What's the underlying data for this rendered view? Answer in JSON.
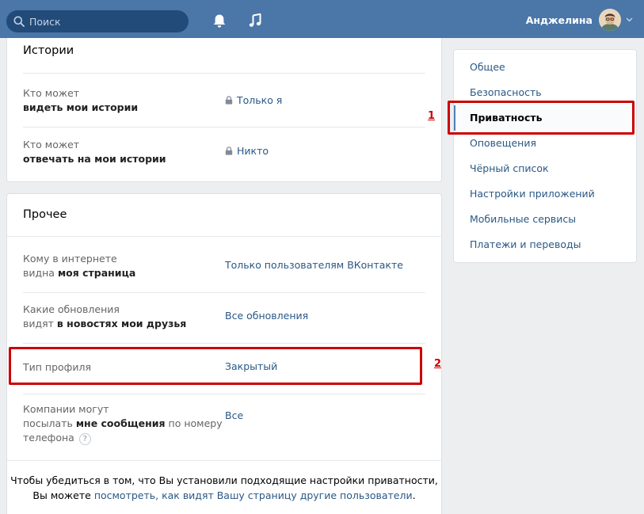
{
  "header": {
    "search_placeholder": "Поиск",
    "user_name": "Анджелина"
  },
  "stories": {
    "title": "Истории",
    "rows": [
      {
        "label_line1": "Кто может",
        "label_line2": "видеть мои истории",
        "value": "Только я"
      },
      {
        "label_line1": "Кто может",
        "label_line2": "отвечать на мои истории",
        "value": "Никто"
      }
    ]
  },
  "other": {
    "title": "Прочее",
    "row1": {
      "l1": "Кому в интернете",
      "l2_pre": "видна ",
      "l2_bold": "моя страница",
      "value": "Только пользователям ВКонтакте"
    },
    "row2": {
      "l1": "Какие обновления",
      "l2_pre": "видят ",
      "l2_bold": "в новостях мои друзья",
      "value": "Все обновления"
    },
    "row3": {
      "label": "Тип профиля",
      "value": "Закрытый"
    },
    "row4": {
      "l1": "Компании могут",
      "l2_pre": "посылать ",
      "l2_bold": "мне сообщения",
      "l2_post": " по номеру",
      "l3": "телефона",
      "help": "?",
      "value": "Все"
    },
    "footer_line1": "Чтобы убедиться в том, что Вы установили подходящие настройки приватности,",
    "footer_pre": "Вы можете ",
    "footer_link": "посмотреть, как видят Вашу страницу другие пользователи",
    "footer_post": "."
  },
  "menu": {
    "items": [
      "Общее",
      "Безопасность",
      "Приватность",
      "Оповещения",
      "Чёрный список",
      "Настройки приложений",
      "Мобильные сервисы",
      "Платежи и переводы"
    ],
    "active_index": 2
  },
  "annotations": {
    "num1": "1",
    "num2": "2"
  },
  "colors": {
    "header": "#4a76a8",
    "link": "#2a5885",
    "annotation": "#cc0000"
  }
}
